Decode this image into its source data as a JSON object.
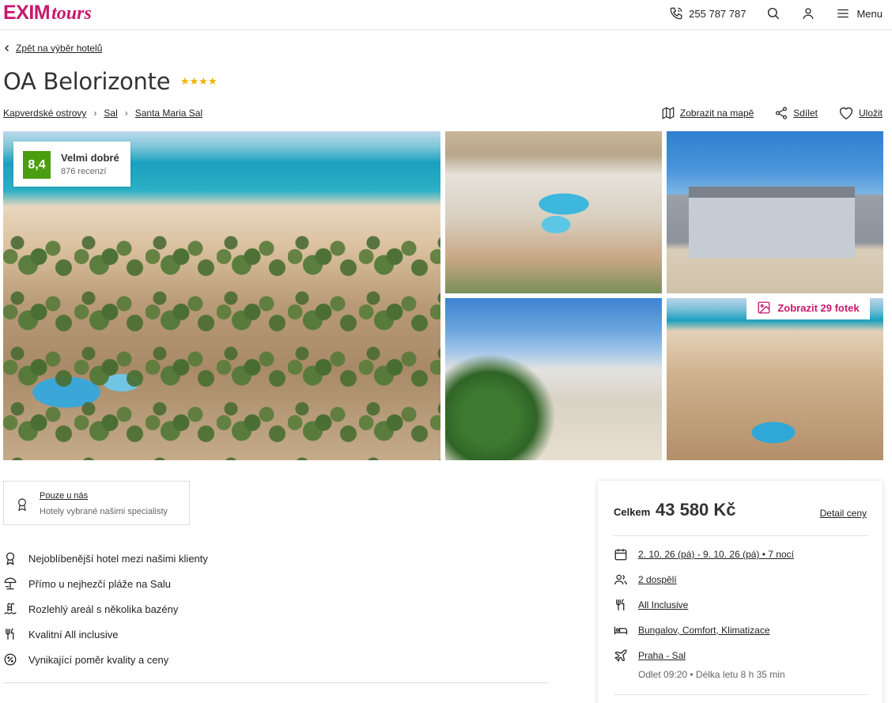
{
  "brand": {
    "name_main": "EXIM",
    "name_script": "tours",
    "color": "#c8186e"
  },
  "header": {
    "phone": "255 787 787",
    "menu_label": "Menu"
  },
  "nav": {
    "back_label": "Zpět na výběr hotelů"
  },
  "hotel": {
    "name": "OA Belorizonte",
    "stars": 4,
    "stars_text": "★★★★",
    "breadcrumb": [
      "Kapverdské ostrovy",
      "Sal",
      "Santa Maria Sal"
    ]
  },
  "actions": {
    "map": "Zobrazit na mapě",
    "share": "Sdílet",
    "save": "Uložit"
  },
  "rating": {
    "score": "8,4",
    "label": "Velmi dobré",
    "reviews": "876 recenzí",
    "color": "#4a9e0f"
  },
  "gallery": {
    "show_photos": "Zobrazit 29 fotek"
  },
  "exclusive": {
    "title": "Pouze u nás",
    "subtitle": "Hotely vybrané našimi specialisty"
  },
  "features": [
    {
      "icon": "award-icon",
      "text": "Nejoblíbenější hotel mezi našimi klienty"
    },
    {
      "icon": "beach-umbrella-icon",
      "text": "Přímo u nejhezčí pláže na Salu"
    },
    {
      "icon": "pool-icon",
      "text": "Rozlehlý areál s několika bazény"
    },
    {
      "icon": "cutlery-icon",
      "text": "Kvalitní All inclusive"
    },
    {
      "icon": "discount-icon",
      "text": "Vynikající poměr kvality a ceny"
    }
  ],
  "price": {
    "total_label": "Celkem",
    "total_value": "43 580 Kč",
    "detail_link": "Detail ceny",
    "dates": "2. 10. 26 (pá) - 9. 10. 26 (pá) • 7 nocí",
    "guests": "2 dospělí",
    "board": "All Inclusive",
    "room": "Bungalov, Comfort, Klimatizace",
    "flight": "Praha - Sal",
    "flight_detail": "Odlet 09:20 • Délka letu 8 h 35 min"
  }
}
